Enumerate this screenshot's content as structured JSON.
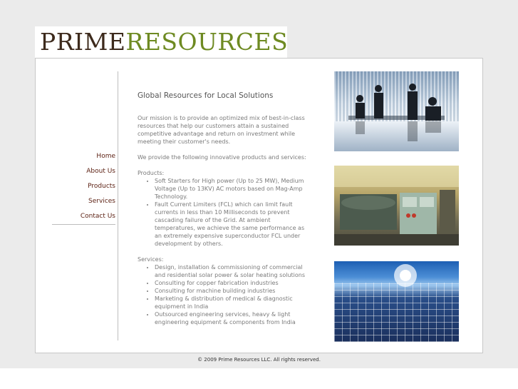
{
  "logo": {
    "word1": "PRIME",
    "word2": "RESOURCES"
  },
  "nav": {
    "items": [
      {
        "label": "Home"
      },
      {
        "label": "About Us"
      },
      {
        "label": "Products"
      },
      {
        "label": "Services"
      },
      {
        "label": "Contact Us"
      }
    ]
  },
  "content": {
    "heading": "Global Resources for Local Solutions",
    "mission": "Our mission is to provide an optimized mix of best-in-class resources that help our customers attain a sustained competitive advantage and return on investment while meeting their customer's needs.",
    "intro": "We provide the following innovative products and services:",
    "products_label": "Products:",
    "products": [
      "Soft Starters for High power (Up to 25 MW), Medium Voltage (Up to 13KV) AC motors based on Mag-Amp Technology.",
      "Fault Current Limiters (FCL) which can limit fault currents in less than 10 Milliseconds to prevent cascading failure of the Grid. At ambient temperatures, we achieve the same performance as an extremely expensive superconductor FCL under development by others."
    ],
    "services_label": "Services:",
    "services": [
      "Design, installation & commissioning of commercial and residential solar power & solar heating solutions",
      "Consulting for copper fabrication industries",
      "Consulting for machine building industries",
      "Marketing & distribution of medical & diagnostic equipment in India",
      "Outsourced engineering services, heavy & light engineering equipment & components from India"
    ]
  },
  "footer": {
    "copyright": "© 2009 Prime Resources LLC. All rights reserved."
  },
  "colors": {
    "brand_dark": "#3d2a1c",
    "brand_green": "#6e8a22",
    "nav_link": "#5a1e10"
  }
}
